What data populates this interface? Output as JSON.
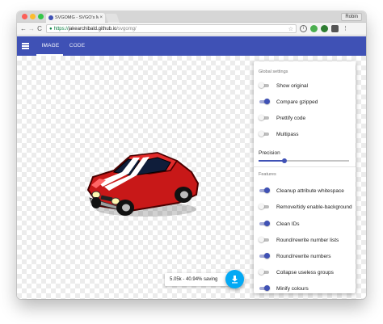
{
  "browser": {
    "tab_title": "SVGOMG - SVGO's Missi",
    "tab_close": "×",
    "profile_name": "Robin",
    "url_scheme": "https://",
    "url_host": "jakearchibald.github.io",
    "url_path": "/svgomg/",
    "back": "←",
    "forward": "→",
    "reload": "C"
  },
  "app": {
    "tabs": [
      {
        "label": "IMAGE",
        "active": true
      },
      {
        "label": "CODE",
        "active": false
      }
    ],
    "accent_color": "#3f51b5",
    "fab_color": "#03a9f4"
  },
  "settings": {
    "global_heading": "Global settings",
    "global": [
      {
        "label": "Show original",
        "on": false
      },
      {
        "label": "Compare gzipped",
        "on": true
      },
      {
        "label": "Prettify code",
        "on": false
      },
      {
        "label": "Multipass",
        "on": false
      }
    ],
    "precision_label": "Precision",
    "precision_level": 0.29,
    "features_heading": "Features",
    "features": [
      {
        "label": "Cleanup attribute whitespace",
        "on": true
      },
      {
        "label": "Remove/tidy enable-background",
        "on": false
      },
      {
        "label": "Clean IDs",
        "on": true
      },
      {
        "label": "Round/rewrite number lists",
        "on": false
      },
      {
        "label": "Round/rewrite numbers",
        "on": true
      },
      {
        "label": "Collapse useless groups",
        "on": false
      },
      {
        "label": "Minify colours",
        "on": true
      }
    ]
  },
  "footer": {
    "saving_text": "5.05k - 40.94% saving",
    "download_icon": "download-icon"
  }
}
